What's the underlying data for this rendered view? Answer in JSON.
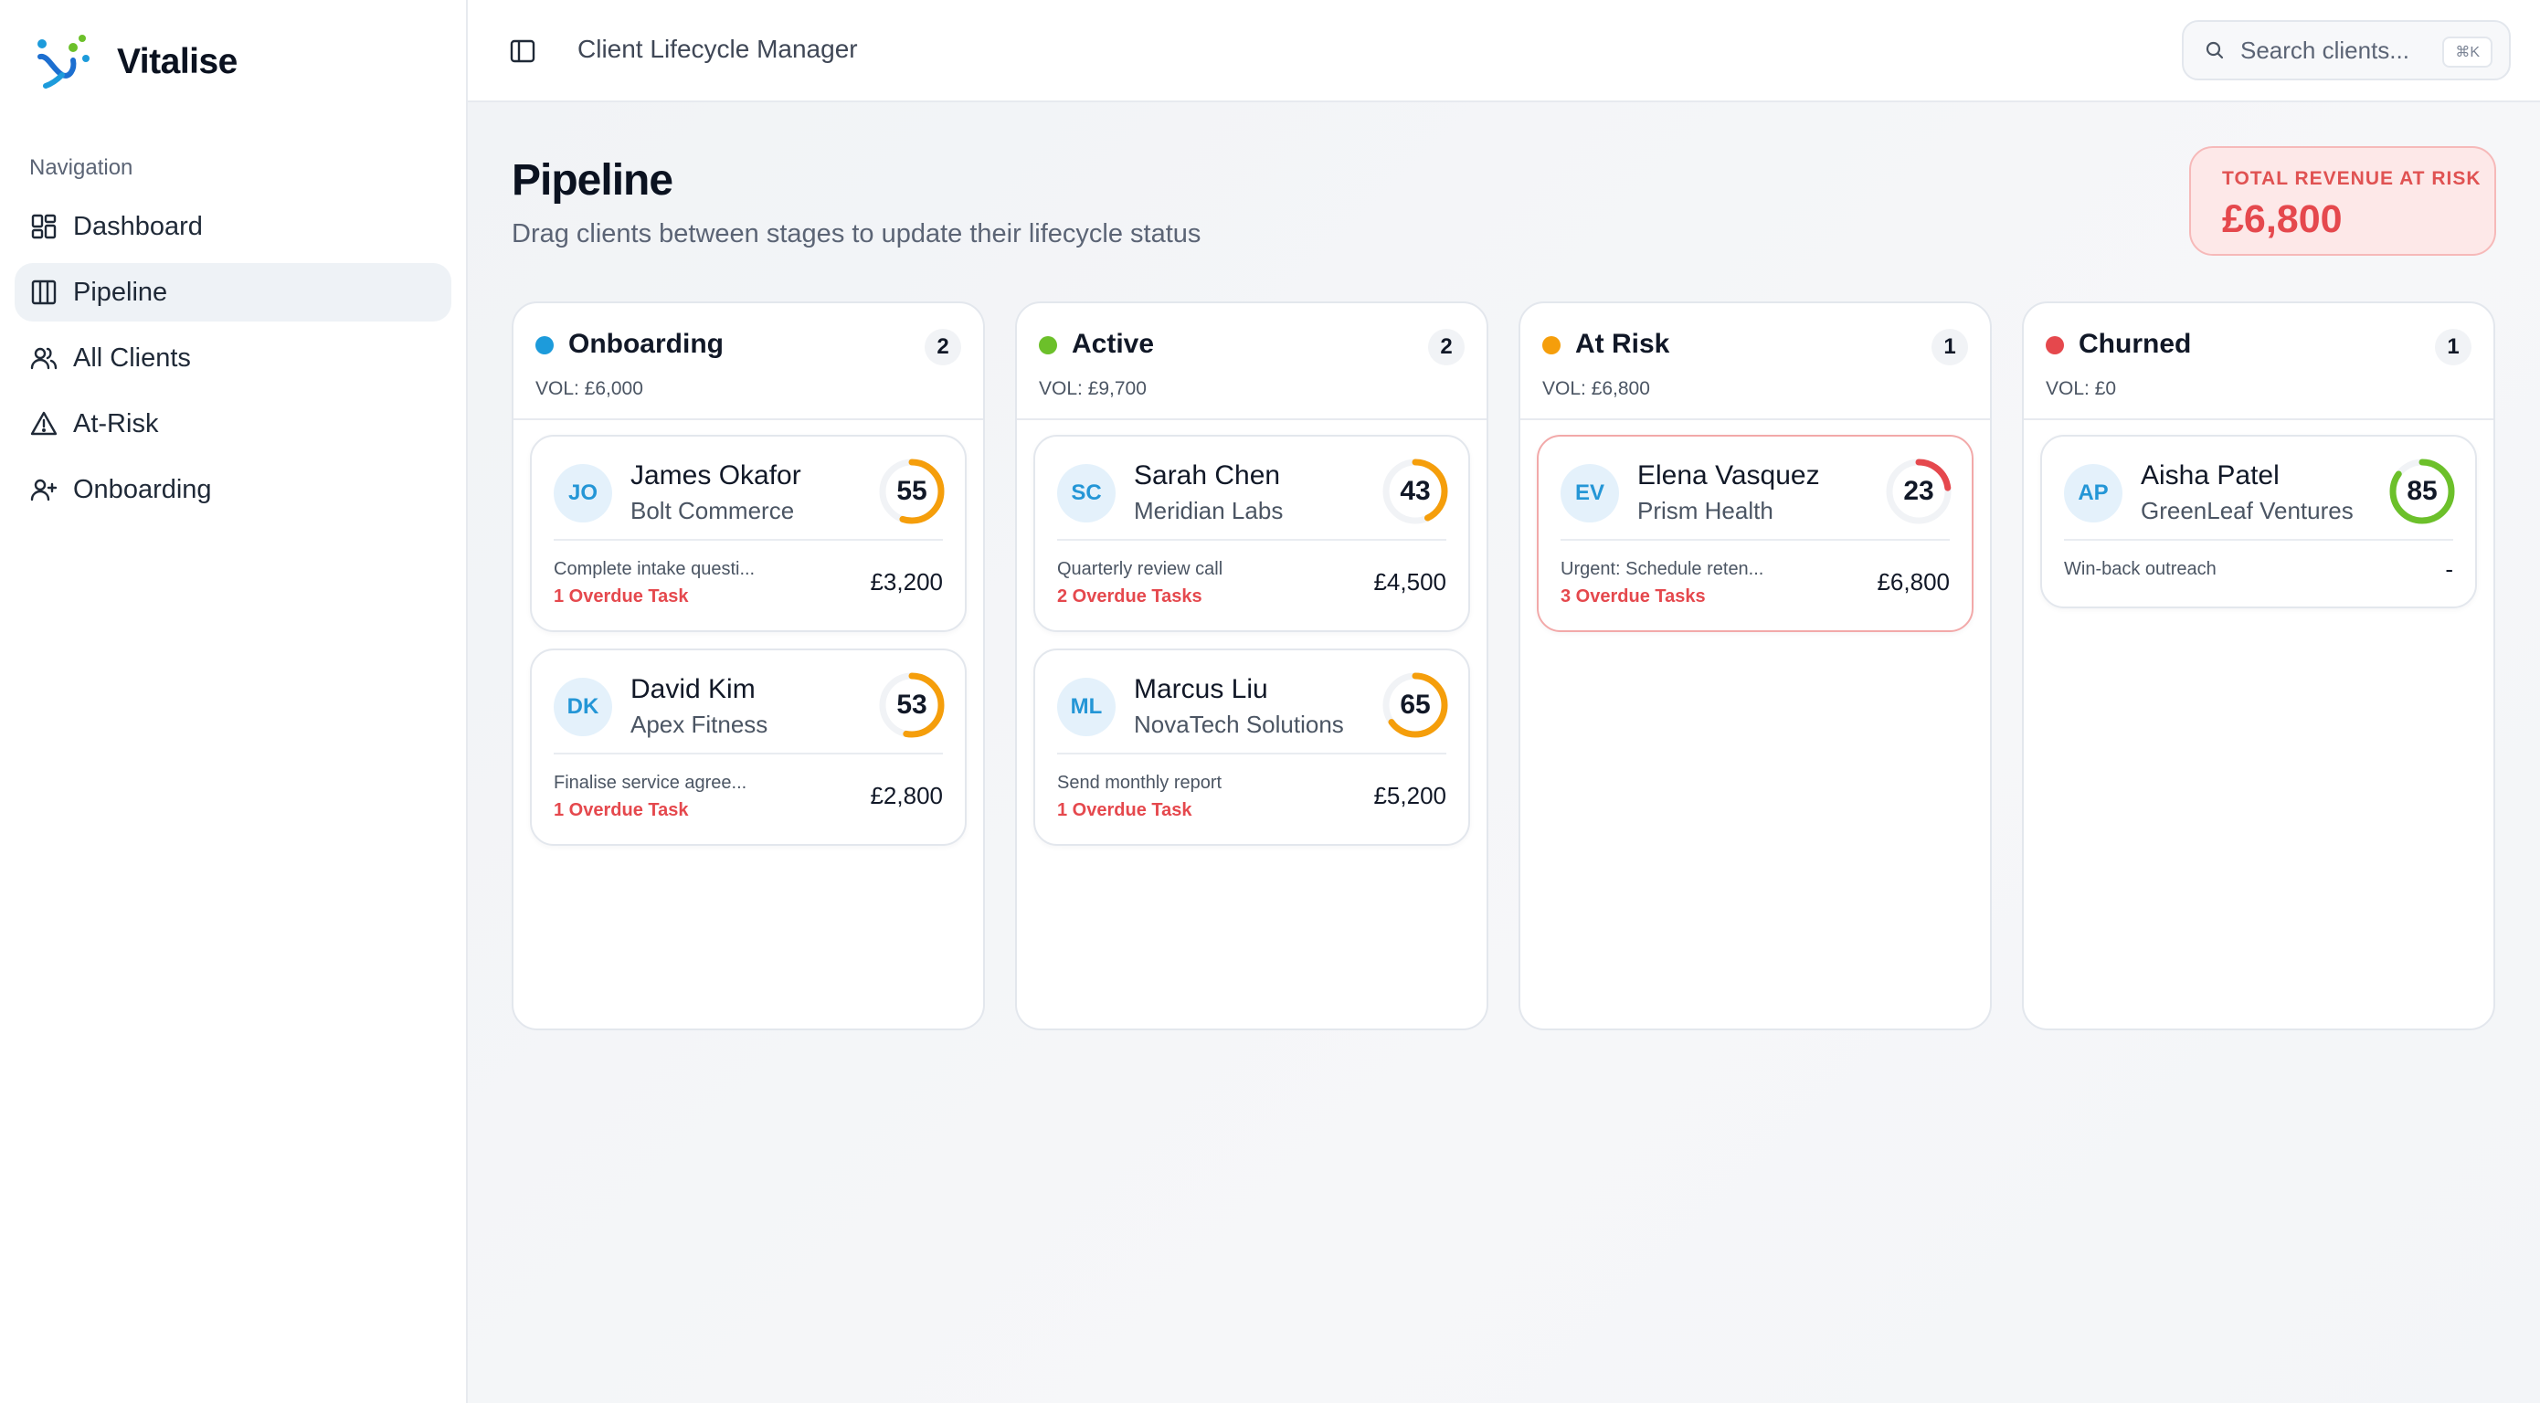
{
  "app": {
    "name": "Vitalise"
  },
  "sidebar": {
    "heading": "Navigation",
    "items": [
      {
        "label": "Dashboard",
        "icon": "dashboard-icon"
      },
      {
        "label": "Pipeline",
        "icon": "kanban-icon",
        "active": true
      },
      {
        "label": "All Clients",
        "icon": "users-icon"
      },
      {
        "label": "At-Risk",
        "icon": "warning-icon"
      },
      {
        "label": "Onboarding",
        "icon": "user-plus-icon"
      }
    ]
  },
  "topbar": {
    "title": "Client Lifecycle Manager",
    "search_placeholder": "Search clients...",
    "search_shortcut": "⌘K"
  },
  "page": {
    "title": "Pipeline",
    "subtitle": "Drag clients between stages to update their lifecycle status",
    "risk_label": "TOTAL REVENUE AT RISK",
    "risk_value": "£6,800"
  },
  "colors": {
    "onboarding": "#1d9bdb",
    "active": "#6cc02a",
    "at_risk": "#f59e0b",
    "churned": "#e5484d"
  },
  "columns": [
    {
      "title": "Onboarding",
      "count": "2",
      "volume": "VOL: £6,000",
      "cards": [
        {
          "initials": "JO",
          "name": "James Okafor",
          "company": "Bolt Commerce",
          "score": "55",
          "score_value": 55,
          "score_color": "#f59e0b",
          "task": "Complete intake questi...",
          "overdue": "1 Overdue Task",
          "amount": "£3,200"
        },
        {
          "initials": "DK",
          "name": "David Kim",
          "company": "Apex Fitness",
          "score": "53",
          "score_value": 53,
          "score_color": "#f59e0b",
          "task": "Finalise service agree...",
          "overdue": "1 Overdue Task",
          "amount": "£2,800"
        }
      ]
    },
    {
      "title": "Active",
      "count": "2",
      "volume": "VOL: £9,700",
      "cards": [
        {
          "initials": "SC",
          "name": "Sarah Chen",
          "company": "Meridian Labs",
          "score": "43",
          "score_value": 43,
          "score_color": "#f59e0b",
          "task": "Quarterly review call",
          "overdue": "2 Overdue Tasks",
          "amount": "£4,500"
        },
        {
          "initials": "ML",
          "name": "Marcus Liu",
          "company": "NovaTech Solutions",
          "score": "65",
          "score_value": 65,
          "score_color": "#f59e0b",
          "task": "Send monthly report",
          "overdue": "1 Overdue Task",
          "amount": "£5,200"
        }
      ]
    },
    {
      "title": "At Risk",
      "count": "1",
      "volume": "VOL: £6,800",
      "cards": [
        {
          "initials": "EV",
          "name": "Elena Vasquez",
          "company": "Prism Health",
          "score": "23",
          "score_value": 23,
          "score_color": "#e5484d",
          "task": "Urgent: Schedule reten...",
          "overdue": "3 Overdue Tasks",
          "amount": "£6,800"
        }
      ]
    },
    {
      "title": "Churned",
      "count": "1",
      "volume": "VOL: £0",
      "cards": [
        {
          "initials": "AP",
          "name": "Aisha Patel",
          "company": "GreenLeaf Ventures",
          "score": "85",
          "score_value": 85,
          "score_color": "#6cc02a",
          "task": "Win-back outreach",
          "overdue": "",
          "amount": "-"
        }
      ]
    }
  ]
}
